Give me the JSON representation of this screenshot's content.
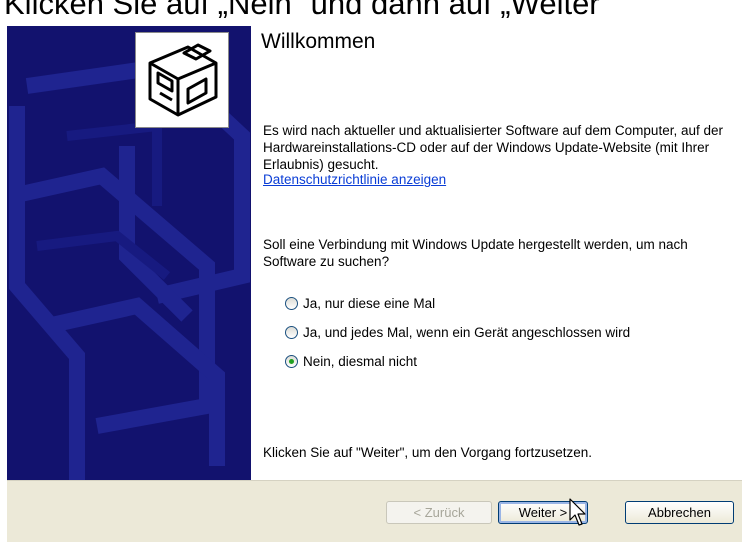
{
  "caption": {
    "text": "Klicken Sie auf „Nein“ und dann auf „Weiter“"
  },
  "wizard": {
    "title": "Willkommen",
    "intro": "Es wird nach aktueller und aktualisierter Software auf dem Computer, auf der Hardwareinstallations-CD oder auf der Windows Update-Website (mit Ihrer Erlaubnis) gesucht.",
    "privacy_link": "Datenschutzrichtlinie anzeigen",
    "question": "Soll eine Verbindung mit Windows Update hergestellt werden, um nach Software zu suchen?",
    "options": [
      {
        "label": "Ja, nur diese eine Mal",
        "checked": false
      },
      {
        "label": "Ja, und jedes Mal, wenn ein Gerät angeschlossen wird",
        "checked": false
      },
      {
        "label": "Nein, diesmal nicht",
        "checked": true
      }
    ],
    "continue_hint": "Klicken Sie auf \"Weiter\", um den Vorgang fortzusetzen."
  },
  "buttons": {
    "back": "< Zurück",
    "next": "Weiter >",
    "cancel": "Abbrechen"
  },
  "icons": {
    "sidebar_logo": "hardware-wizard-icon",
    "cursor": "mouse-pointer-icon"
  },
  "colors": {
    "sidebar": "#12126e",
    "link": "#0a3dd6",
    "button_bar": "#ece9d8",
    "radio_selected": "#21a121"
  }
}
